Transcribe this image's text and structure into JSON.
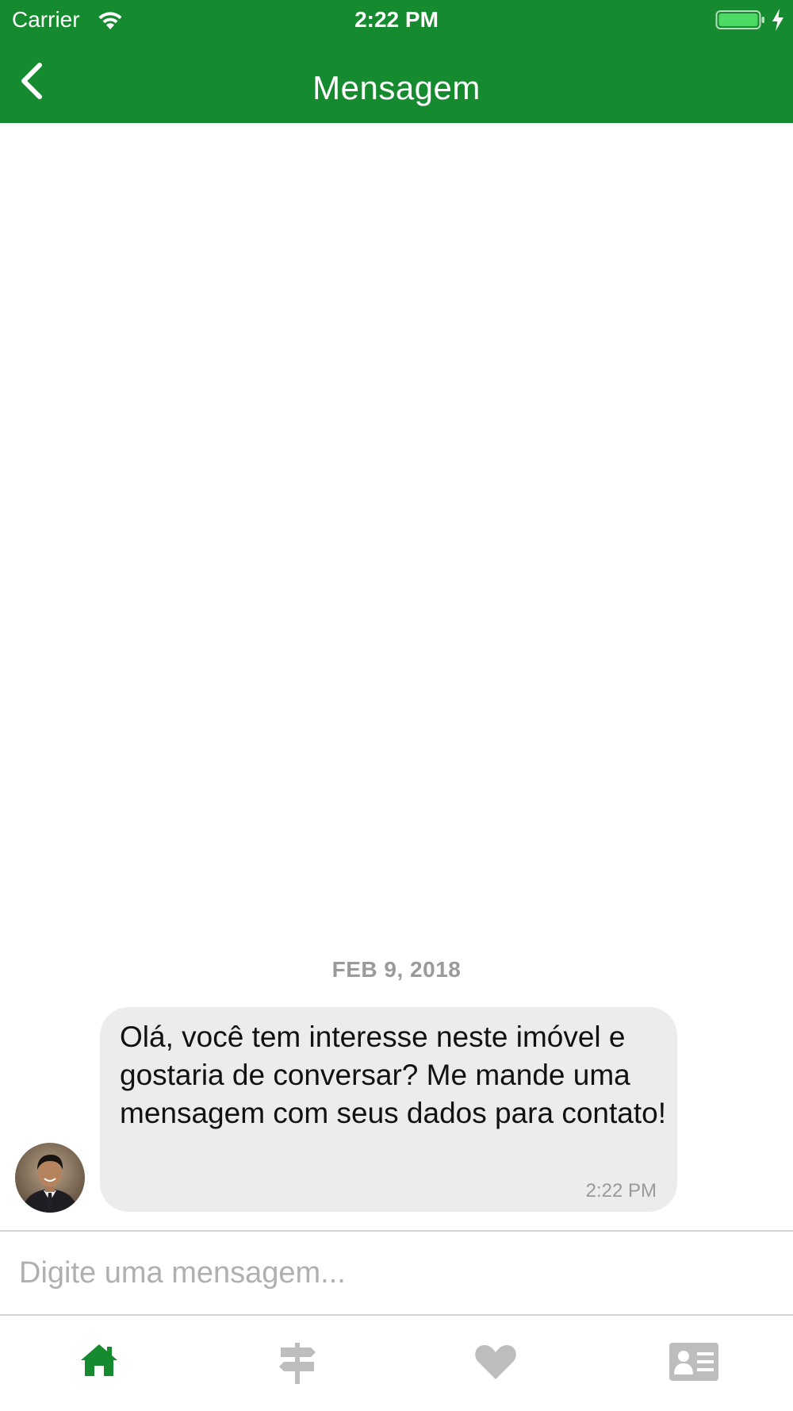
{
  "status_bar": {
    "carrier": "Carrier",
    "time": "2:22 PM",
    "wifi_icon": "wifi-icon",
    "battery_icon": "battery-icon",
    "charging_icon": "charging-bolt-icon",
    "battery_level": 1.0
  },
  "nav": {
    "title": "Mensagem",
    "back_icon": "chevron-left-icon"
  },
  "chat": {
    "date_separator": "FEB 9, 2018",
    "messages": [
      {
        "text": "Olá, você tem interesse neste imóvel e gostaria de conversar? Me mande uma mensagem com seus dados para contato!",
        "time": "2:22 PM",
        "sender_avatar": "avatar"
      }
    ]
  },
  "composer": {
    "placeholder": "Digite uma mensagem..."
  },
  "tab_bar": {
    "tabs": [
      {
        "icon": "home-icon",
        "active": true
      },
      {
        "icon": "signpost-icon",
        "active": false
      },
      {
        "icon": "heart-icon",
        "active": false
      },
      {
        "icon": "contact-card-icon",
        "active": false
      }
    ]
  },
  "colors": {
    "header_green": "#168A2E",
    "active_tab": "#168A2E",
    "inactive_tab": "#BDBDBD",
    "bubble_bg": "#ECECEC",
    "battery_green": "#4CD964"
  }
}
